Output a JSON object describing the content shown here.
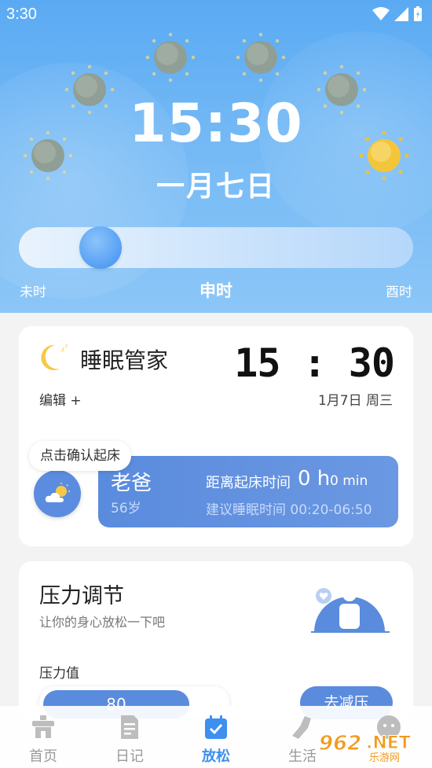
{
  "status": {
    "time": "3:30"
  },
  "hero": {
    "time": "15:30",
    "date": "一月七日",
    "slider": {
      "left_label": "未时",
      "center_label": "申时",
      "right_label": "酉时",
      "position_fraction": 0.21
    }
  },
  "sleep": {
    "title": "睡眠管家",
    "clock": "15 : 30",
    "edit_label": "编辑 +",
    "date": "1月7日 周三",
    "confirm_label": "点击确认起床",
    "person": {
      "name": "老爸",
      "age": "56岁",
      "wake_label": "距离起床时间",
      "wake_hours": "0 h",
      "wake_minutes": "0 min",
      "suggest": "建议睡眠时间 00:20-06:50"
    }
  },
  "stress": {
    "title": "压力调节",
    "subtitle": "让你的身心放松一下吧",
    "value_label": "压力值",
    "value": "80",
    "button_label": "去减压"
  },
  "tabs": [
    {
      "label": "首页",
      "icon": "home-icon",
      "active": false
    },
    {
      "label": "日记",
      "icon": "diary-icon",
      "active": false
    },
    {
      "label": "放松",
      "icon": "calendar-check-icon",
      "active": true
    },
    {
      "label": "生活",
      "icon": "shoe-icon",
      "active": false
    },
    {
      "label": "",
      "icon": "profile-icon",
      "active": false
    }
  ],
  "watermark": {
    "text_main": "962",
    "text_suffix": ".NET",
    "text_sub": "乐游网"
  },
  "colors": {
    "accent": "#3d8ff0",
    "panel": "#5a8bdd",
    "sky": "#5aaaf3"
  }
}
